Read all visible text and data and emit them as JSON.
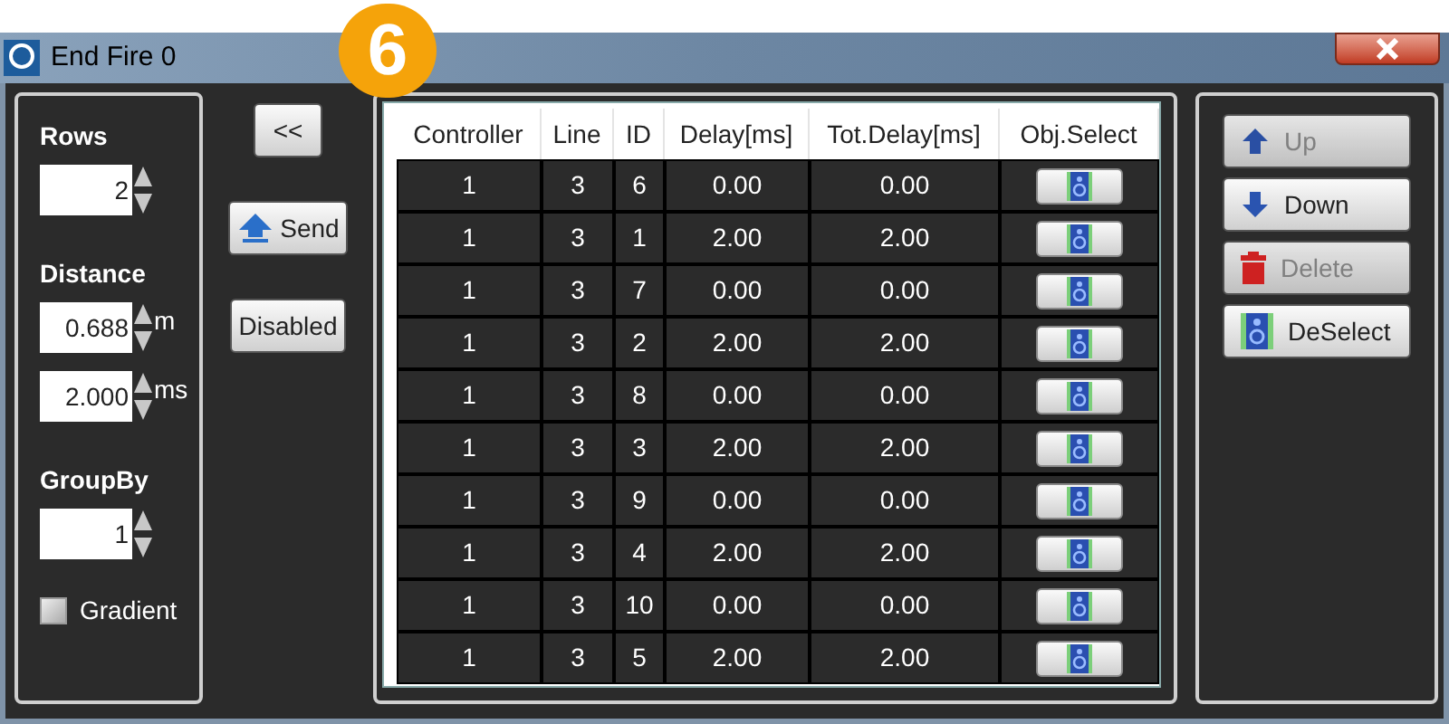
{
  "window": {
    "title": "End Fire 0"
  },
  "badge": "6",
  "left_panel": [
    {
      "kind": "label",
      "text": "Rows"
    },
    {
      "kind": "spinner",
      "value": "2"
    },
    {
      "kind": "label",
      "text": "Distance"
    },
    {
      "kind": "spinner",
      "value": "0.688",
      "unit": "m"
    },
    {
      "kind": "spinner",
      "value": "2.000",
      "unit": "ms"
    },
    {
      "kind": "label",
      "text": "GroupBy"
    },
    {
      "kind": "spinner",
      "value": "1"
    },
    {
      "kind": "checkbox",
      "label": "Gradient",
      "checked": false
    }
  ],
  "middle_buttons": [
    {
      "kind": "plain",
      "label": "<<"
    },
    {
      "kind": "send",
      "label": "Send"
    },
    {
      "kind": "plain",
      "label": "Disabled"
    }
  ],
  "table": {
    "columns": [
      "Controller",
      "Line",
      "ID",
      "Delay[ms]",
      "Tot.Delay[ms]",
      "Obj.Select"
    ],
    "rows": [
      [
        "1",
        "3",
        "6",
        "0.00",
        "0.00"
      ],
      [
        "1",
        "3",
        "1",
        "2.00",
        "2.00"
      ],
      [
        "1",
        "3",
        "7",
        "0.00",
        "0.00"
      ],
      [
        "1",
        "3",
        "2",
        "2.00",
        "2.00"
      ],
      [
        "1",
        "3",
        "8",
        "0.00",
        "0.00"
      ],
      [
        "1",
        "3",
        "3",
        "2.00",
        "2.00"
      ],
      [
        "1",
        "3",
        "9",
        "0.00",
        "0.00"
      ],
      [
        "1",
        "3",
        "4",
        "2.00",
        "2.00"
      ],
      [
        "1",
        "3",
        "10",
        "0.00",
        "0.00"
      ],
      [
        "1",
        "3",
        "5",
        "2.00",
        "2.00"
      ]
    ]
  },
  "right_buttons": [
    {
      "kind": "up",
      "label": "Up",
      "disabled": true
    },
    {
      "kind": "down",
      "label": "Down",
      "disabled": false
    },
    {
      "kind": "delete",
      "label": "Delete",
      "disabled": true
    },
    {
      "kind": "deselect",
      "label": "DeSelect",
      "disabled": false
    }
  ]
}
